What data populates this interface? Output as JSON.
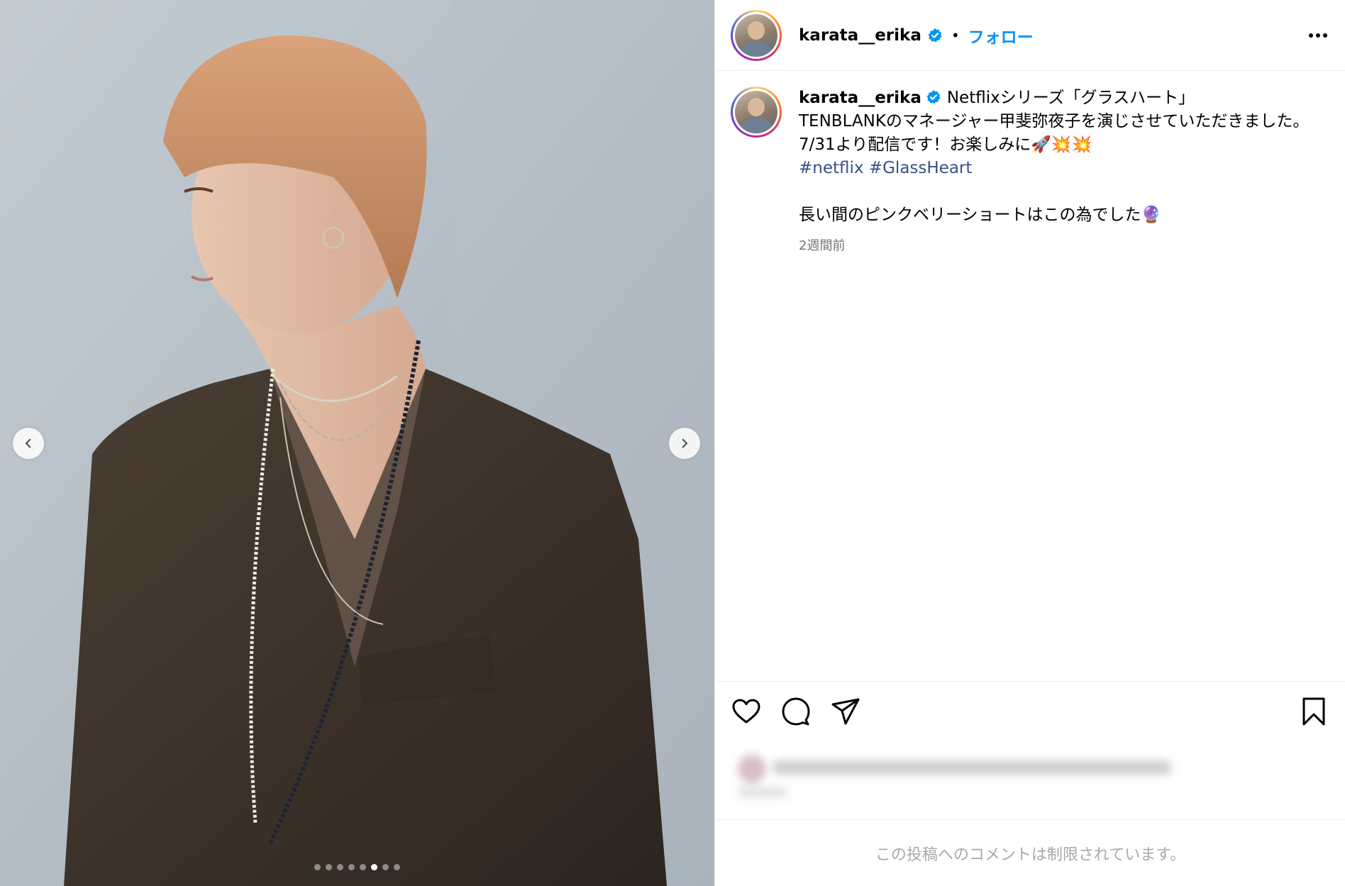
{
  "colors": {
    "accent": "#0095f6",
    "verified": "#0095f6",
    "hashtag": "#385185",
    "muted": "#737373",
    "restricted_text": "#a8a8a8"
  },
  "header": {
    "username": "karata__erika",
    "separator": "•",
    "follow_label": "フォロー",
    "more_icon": "more-horizontal-icon"
  },
  "media": {
    "prev_icon": "chevron-left-icon",
    "next_icon": "chevron-right-icon",
    "slide_count": 8,
    "active_slide": 6
  },
  "caption": {
    "username": "karata__erika",
    "line1": "Netflixシリーズ「グラスハート」",
    "line2": "TENBLANKのマネージャー甲斐弥夜子を演じさせていただきました。",
    "line3": "7/31より配信です！お楽しみに🚀💥💥",
    "hashtag1": "#netflix",
    "hashtag2": "#GlassHeart",
    "line5": "長い間のピンクベリーショートはこの為でした🔮",
    "time_ago": "2週間前"
  },
  "actions": {
    "like_icon": "heart-icon",
    "comment_icon": "comment-icon",
    "share_icon": "send-icon",
    "save_icon": "bookmark-icon"
  },
  "footer": {
    "comments_restricted": "この投稿へのコメントは制限されています。"
  }
}
